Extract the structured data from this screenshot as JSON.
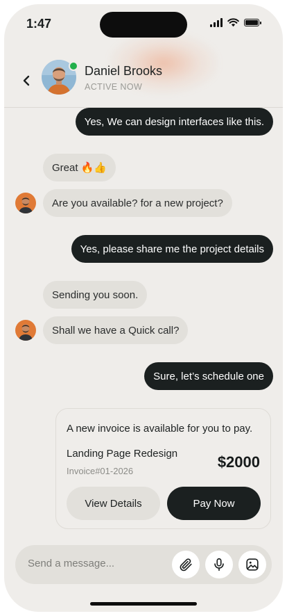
{
  "status_bar": {
    "time": "1:47"
  },
  "header": {
    "contact_name": "Daniel Brooks",
    "contact_status": "ACTIVE NOW",
    "online_color": "#22b04b"
  },
  "icons": {
    "back": "chevron-left-icon",
    "attach": "paperclip-icon",
    "mic": "microphone-icon",
    "gallery": "image-icon"
  },
  "messages": [
    {
      "from": "me",
      "text": "Yes, We can design interfaces like this."
    },
    {
      "from": "them",
      "text": "Great 🔥👍"
    },
    {
      "from": "them",
      "text": "Are you available? for a new project?"
    },
    {
      "from": "me",
      "text": "Yes, please share me the project details"
    },
    {
      "from": "them",
      "text": "Sending you soon."
    },
    {
      "from": "them",
      "text": "Shall we have a Quick call?"
    },
    {
      "from": "me",
      "text": "Sure, let’s schedule one"
    }
  ],
  "invoice": {
    "title": "A new invoice is available for you to pay.",
    "item": "Landing Page Redesign",
    "number": "Invoice#01-2026",
    "amount": "$2000",
    "view_label": "View Details",
    "pay_label": "Pay Now"
  },
  "composer": {
    "placeholder": "Send a message..."
  },
  "colors": {
    "background": "#efedea",
    "bubble_out": "#1b2020",
    "bubble_in": "#e2e0db",
    "accent_glow": "#ed8d62"
  }
}
